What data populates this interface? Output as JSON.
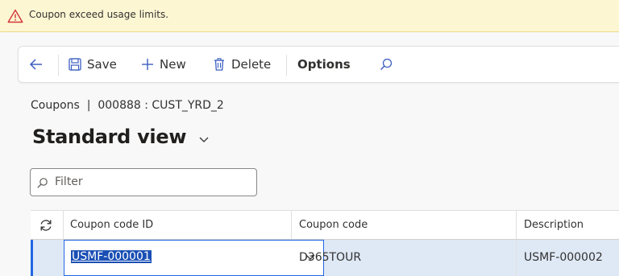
{
  "notification": {
    "message": "Coupon exceed usage limits.",
    "type": "warning",
    "icon": "warning-triangle-icon"
  },
  "toolbar": {
    "back_icon": "back-arrow-icon",
    "save_label": "Save",
    "new_label": "New",
    "delete_label": "Delete",
    "options_label": "Options",
    "search_icon": "search-icon"
  },
  "breadcrumb": {
    "text": "Coupons  |  000888 : CUST_YRD_2"
  },
  "view": {
    "title": "Standard view"
  },
  "filter": {
    "placeholder": "Filter",
    "value": ""
  },
  "grid": {
    "columns": [
      "Coupon code ID",
      "Coupon code",
      "Description"
    ],
    "rows": [
      {
        "coupon_code_id": "USMF-000001",
        "coupon_code": "D365TOUR",
        "description": "USMF-000002",
        "selected": true
      }
    ]
  },
  "colors": {
    "warning_bg": "#fdf6d3",
    "accent": "#2266e3",
    "selected_row": "#dfe9f6",
    "warning_icon": "#d13438"
  }
}
